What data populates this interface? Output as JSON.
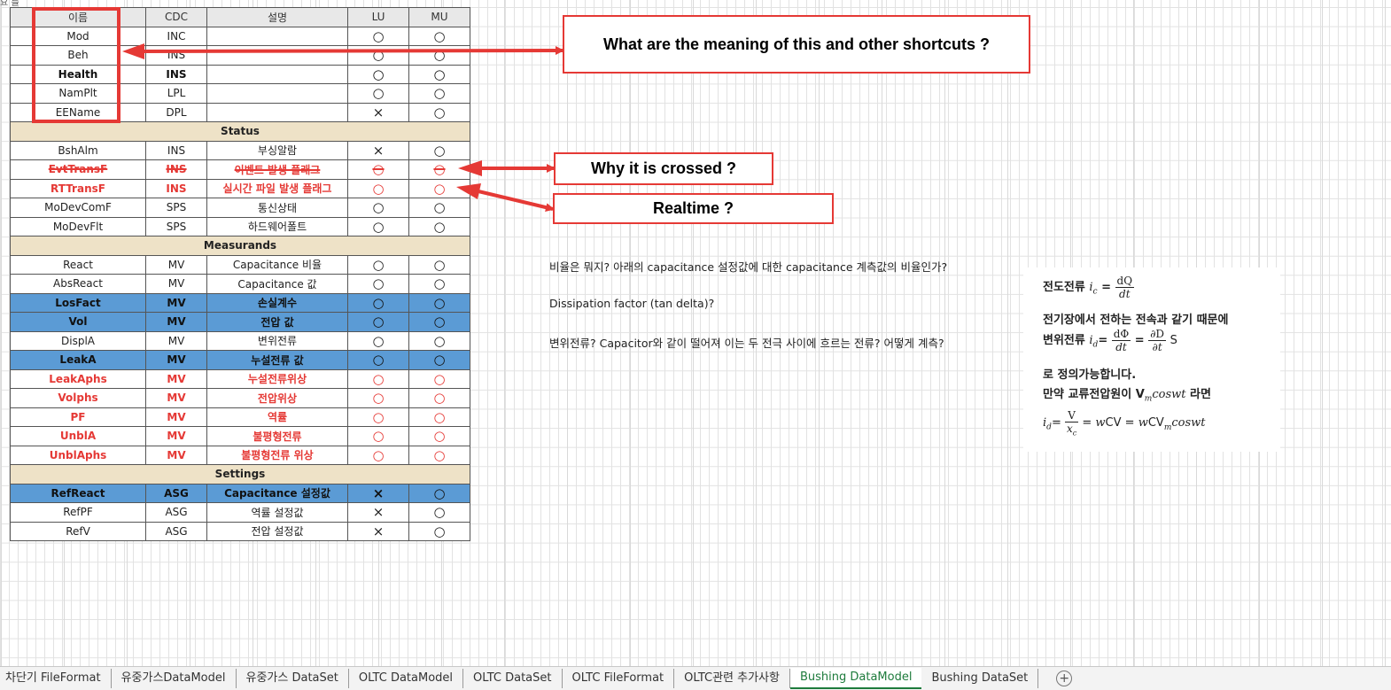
{
  "top_cut_text": "요 를",
  "table": {
    "headers": [
      "이름",
      "CDC",
      "설명",
      "LU",
      "MU"
    ],
    "rows": [
      {
        "style": "normal",
        "name": "Mod",
        "cdc": "INC",
        "desc": "",
        "lu": "○",
        "mu": "○"
      },
      {
        "style": "normal",
        "name": "Beh",
        "cdc": "INS",
        "desc": "",
        "lu": "○",
        "mu": "○"
      },
      {
        "style": "bold",
        "name": "Health",
        "cdc": "INS",
        "desc": "",
        "lu": "○",
        "mu": "○"
      },
      {
        "style": "normal",
        "name": "NamPlt",
        "cdc": "LPL",
        "desc": "",
        "lu": "○",
        "mu": "○"
      },
      {
        "style": "normal",
        "name": "EEName",
        "cdc": "DPL",
        "desc": "",
        "lu": "×",
        "mu": "○"
      },
      {
        "style": "section",
        "label": "Status"
      },
      {
        "style": "normal",
        "name": "BshAlm",
        "cdc": "INS",
        "desc": "부싱알람",
        "lu": "×",
        "mu": "○"
      },
      {
        "style": "red-strike",
        "name": "EvtTransF",
        "cdc": "INS",
        "desc": "이벤트 발생 플래그",
        "lu": "○",
        "mu": "○"
      },
      {
        "style": "red",
        "name": "RTTransF",
        "cdc": "INS",
        "desc": "실시간 파일 발생 플래그",
        "lu": "○",
        "mu": "○"
      },
      {
        "style": "normal",
        "name": "MoDevComF",
        "cdc": "SPS",
        "desc": "통신상태",
        "lu": "○",
        "mu": "○"
      },
      {
        "style": "normal",
        "name": "MoDevFlt",
        "cdc": "SPS",
        "desc": "하드웨어폴트",
        "lu": "○",
        "mu": "○"
      },
      {
        "style": "section",
        "label": "Measurands"
      },
      {
        "style": "normal",
        "name": "React",
        "cdc": "MV",
        "desc": "Capacitance 비율",
        "lu": "○",
        "mu": "○"
      },
      {
        "style": "normal",
        "name": "AbsReact",
        "cdc": "MV",
        "desc": "Capacitance 값",
        "lu": "○",
        "mu": "○"
      },
      {
        "style": "highlight",
        "name": "LosFact",
        "cdc": "MV",
        "desc": "손실계수",
        "lu": "○",
        "mu": "○"
      },
      {
        "style": "highlight",
        "name": "Vol",
        "cdc": "MV",
        "desc": "전압 값",
        "lu": "○",
        "mu": "○"
      },
      {
        "style": "normal",
        "name": "DisplA",
        "cdc": "MV",
        "desc": "변위전류",
        "lu": "○",
        "mu": "○"
      },
      {
        "style": "highlight",
        "name": "LeakA",
        "cdc": "MV",
        "desc": "누설전류 값",
        "lu": "○",
        "mu": "○"
      },
      {
        "style": "red",
        "name": "LeakAphs",
        "cdc": "MV",
        "desc": "누설전류위상",
        "lu": "○",
        "mu": "○"
      },
      {
        "style": "red",
        "name": "Volphs",
        "cdc": "MV",
        "desc": "전압위상",
        "lu": "○",
        "mu": "○"
      },
      {
        "style": "red",
        "name": "PF",
        "cdc": "MV",
        "desc": "역률",
        "lu": "○",
        "mu": "○"
      },
      {
        "style": "red",
        "name": "UnblA",
        "cdc": "MV",
        "desc": "불평형전류",
        "lu": "○",
        "mu": "○"
      },
      {
        "style": "red",
        "name": "UnblAphs",
        "cdc": "MV",
        "desc": "불평형전류 위상",
        "lu": "○",
        "mu": "○"
      },
      {
        "style": "section",
        "label": "Settings"
      },
      {
        "style": "highlight",
        "name": "RefReact",
        "cdc": "ASG",
        "desc": "Capacitance 설정값",
        "lu": "×",
        "mu": "○"
      },
      {
        "style": "normal",
        "name": "RefPF",
        "cdc": "ASG",
        "desc": "역률 설정값",
        "lu": "×",
        "mu": "○"
      },
      {
        "style": "normal",
        "name": "RefV",
        "cdc": "ASG",
        "desc": "전압 설정값",
        "lu": "×",
        "mu": "○"
      }
    ]
  },
  "callouts": {
    "shortcuts": "What are the meaning of this and other shortcuts ?",
    "crossed": "Why it is crossed ?",
    "realtime": "Realtime ?"
  },
  "notes": {
    "ratio": "비율은 뭐지? 아래의 capacitance 설정값에 대한 capacitance 계측값의 비율인가?",
    "dissipation": "Dissipation factor (tan delta)?",
    "displacement": "변위전류? Capacitor와 같이 떨어져 이는 두 전극 사이에 흐르는 전류? 어떻게 계측?"
  },
  "formula": {
    "line1_label": "전도전류",
    "line2": "전기장에서 전하는 전속과 같기 때문에",
    "line3_label": "변위전류",
    "line3_unit": "S",
    "line4": "로 정의가능합니다.",
    "line5a": "만약 교류전압원이 V",
    "line5b": "라면"
  },
  "sheet_tabs": [
    {
      "label": "차단기 FileFormat",
      "active": false
    },
    {
      "label": "유중가스DataModel",
      "active": false
    },
    {
      "label": "유중가스 DataSet",
      "active": false
    },
    {
      "label": "OLTC DataModel",
      "active": false
    },
    {
      "label": "OLTC DataSet",
      "active": false
    },
    {
      "label": "OLTC FileFormat",
      "active": false
    },
    {
      "label": "OLTC관련 추가사항",
      "active": false
    },
    {
      "label": "Bushing DataModel",
      "active": true
    },
    {
      "label": "Bushing DataSet",
      "active": false
    }
  ],
  "add_sheet_symbol": "+",
  "colors": {
    "callout_red": "#e53935",
    "highlight_blue": "#5b9bd5",
    "section_beige": "#eee2c7",
    "active_tab_green": "#1e7b3c"
  }
}
